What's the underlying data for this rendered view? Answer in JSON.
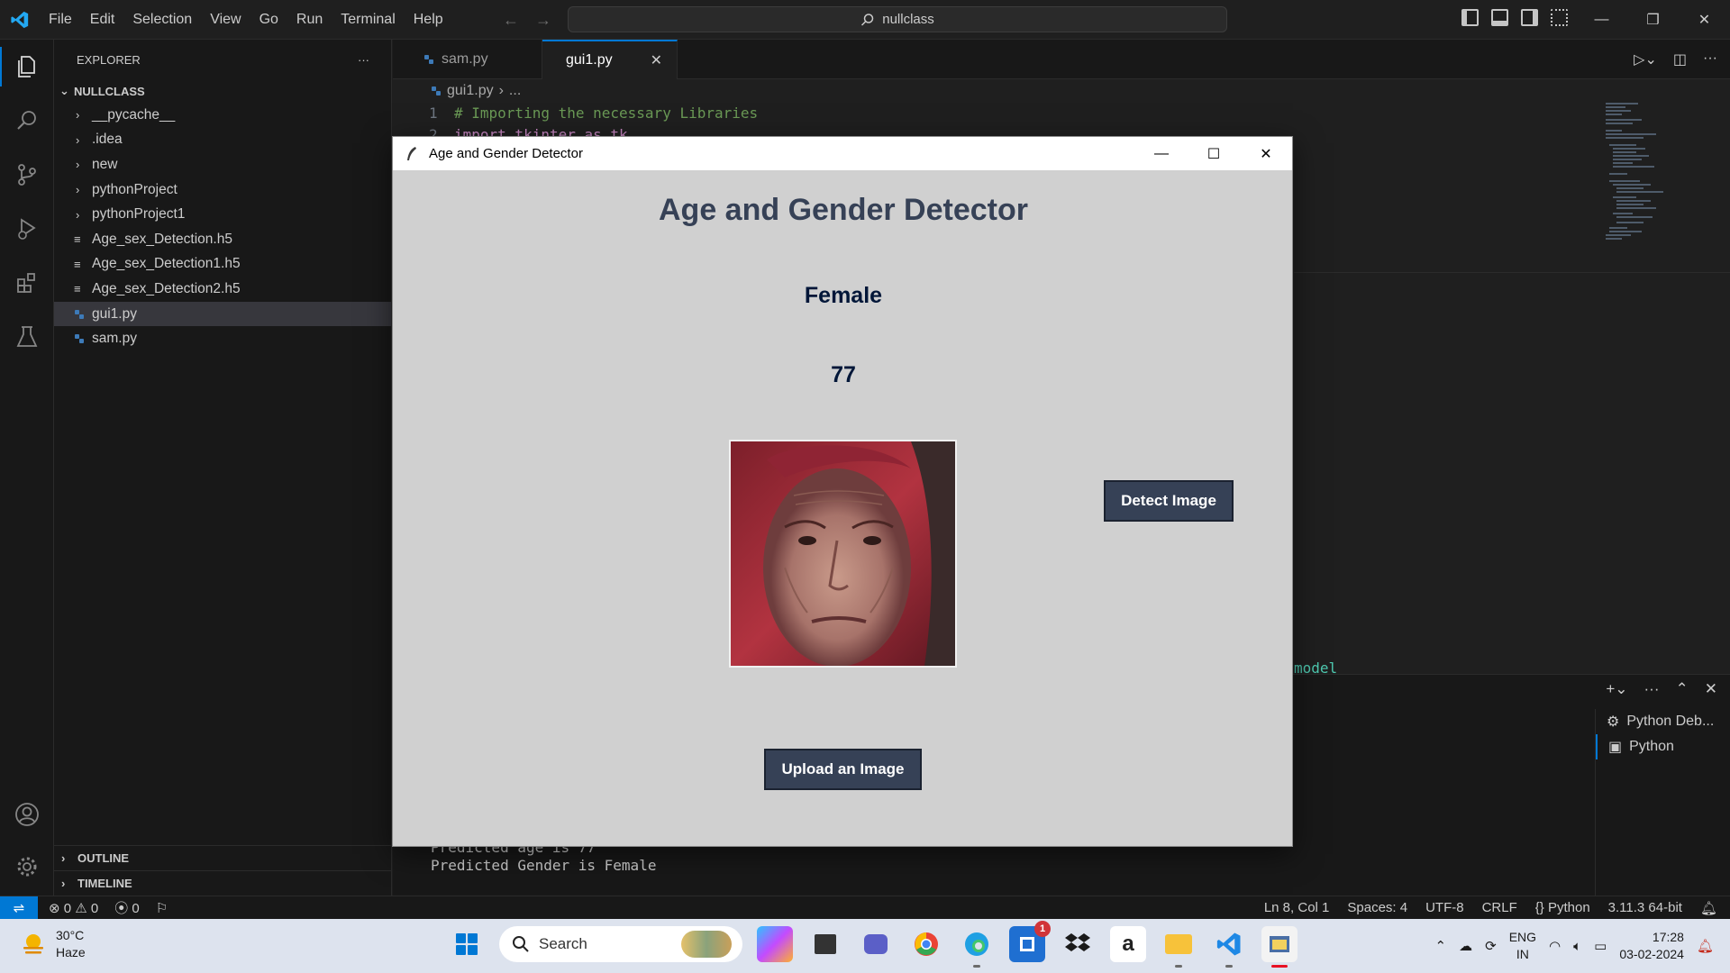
{
  "titlebar": {
    "menu": [
      "File",
      "Edit",
      "Selection",
      "View",
      "Go",
      "Run",
      "Terminal",
      "Help"
    ],
    "search_text": "nullclass"
  },
  "explorer": {
    "header": "EXPLORER",
    "root": "NULLCLASS",
    "folders": [
      "__pycache__",
      ".idea",
      "new",
      "pythonProject",
      "pythonProject1"
    ],
    "files": [
      "Age_sex_Detection.h5",
      "Age_sex_Detection1.h5",
      "Age_sex_Detection2.h5"
    ],
    "py_files": [
      "gui1.py",
      "sam.py"
    ],
    "outline": "OUTLINE",
    "timeline": "TIMELINE"
  },
  "tabs": [
    {
      "label": "sam.py"
    },
    {
      "label": "gui1.py"
    }
  ],
  "editor": {
    "breadcrumb_file": "gui1.py",
    "breadcrumb_rest": "...",
    "lines": [
      {
        "num": "1",
        "text": "# Importing the necessary Libraries"
      },
      {
        "num": "2",
        "text": "import tkinter as tk"
      }
    ],
    "peek_text": "model"
  },
  "panel": {
    "terminal_lines": [
      "Predicted age is 77",
      "Predicted Gender is Female"
    ],
    "terminals": [
      "Python Deb...",
      "Python"
    ]
  },
  "statusbar": {
    "errors": "0",
    "warnings": "0",
    "ports": "0",
    "position": "Ln 8, Col 1",
    "spaces": "Spaces: 4",
    "encoding": "UTF-8",
    "eol": "CRLF",
    "language": "Python",
    "interpreter": "3.11.3 64-bit"
  },
  "dialog": {
    "window_title": "Age and Gender Detector",
    "heading": "Age and Gender Detector",
    "gender": "Female",
    "age": "77",
    "detect_button": "Detect Image",
    "upload_button": "Upload an Image"
  },
  "taskbar": {
    "temperature": "30°C",
    "condition": "Haze",
    "search_placeholder": "Search",
    "store_badge": "1",
    "lang_top": "ENG",
    "lang_bottom": "IN",
    "time": "17:28",
    "date": "03-02-2024"
  },
  "colors": {
    "accent": "#0078d4",
    "dialog_bg": "#d0d0d0",
    "button_bg": "#364156",
    "label_color": "#011638"
  }
}
